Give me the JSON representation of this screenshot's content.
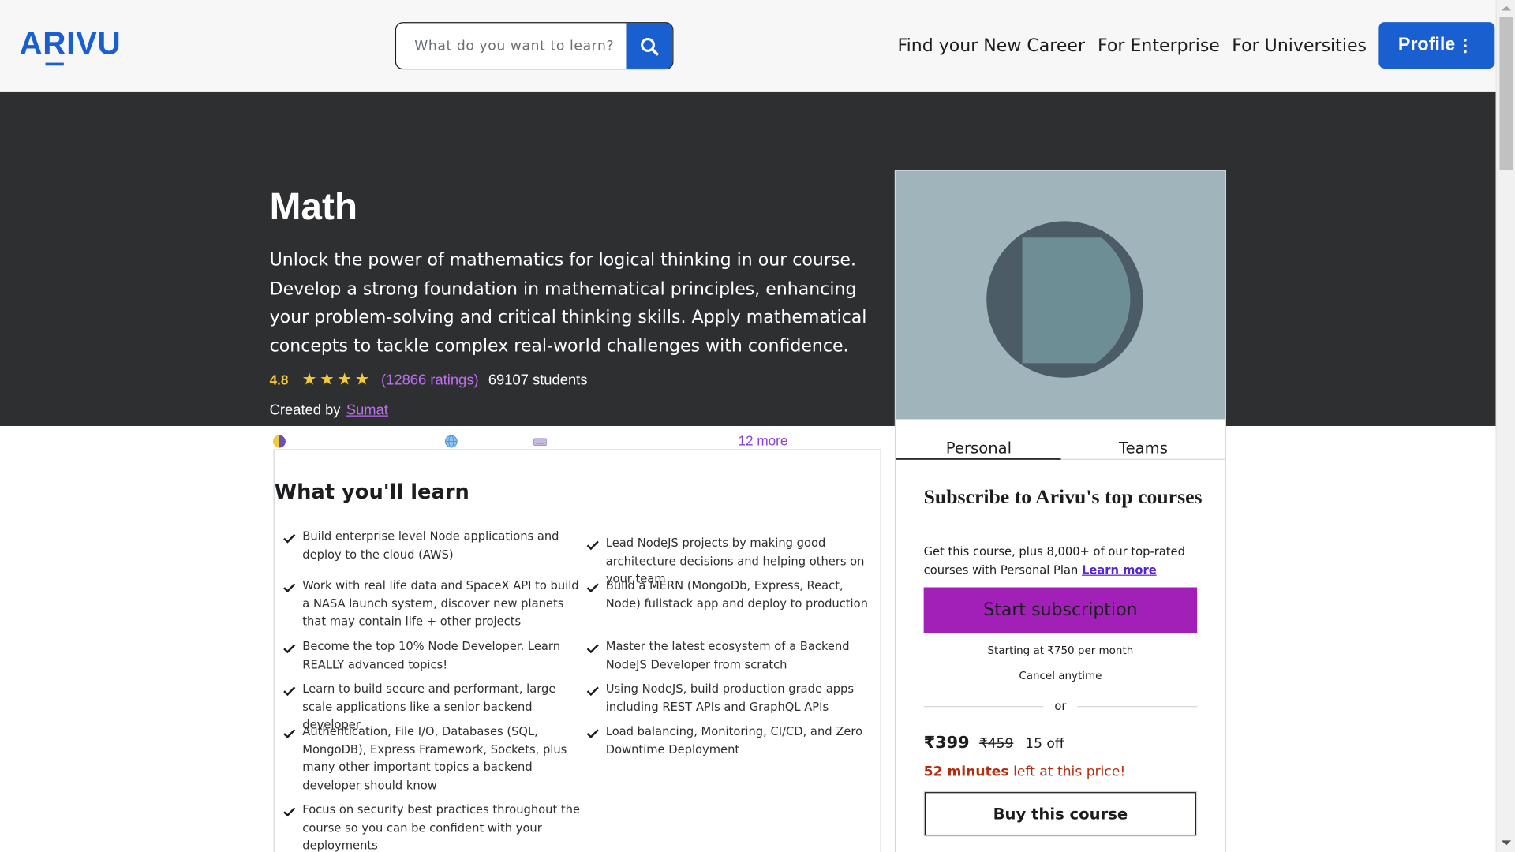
{
  "header": {
    "logo": "ARIVU",
    "search_placeholder": "What do you want to learn?",
    "nav": [
      "Find your New Career",
      "For Enterprise",
      "For Universities"
    ],
    "profile_label": "Profile"
  },
  "course": {
    "title": "Math",
    "description": "Unlock the power of mathematics for logical thinking in our course. Develop a strong foundation in mathematical principles, enhancing your problem-solving and critical thinking skills. Apply mathematical concepts to tackle complex real-world challenges with confidence.",
    "rating": "4.8",
    "ratings_count": "(12866 ratings)",
    "students": "69107 students",
    "created_by_label": "Created by",
    "author": "Sumat",
    "more_label": "12 more",
    "star_rating": 4.8
  },
  "learn": {
    "heading": "What you'll learn",
    "left": [
      "Build enterprise level Node applications and deploy to the cloud (AWS)",
      "Work with real life data and SpaceX API to build a NASA launch system, discover new planets that may contain life + other projects",
      "Become the top 10% Node Developer. Learn REALLY advanced topics!",
      "Learn to build secure and performant, large scale applications like a senior backend developer",
      "Authentication, File I/O, Databases (SQL, MongoDB), Express Framework, Sockets, plus many other important topics a backend developer should know",
      "Focus on security best practices throughout the course so you can be confident with your deployments"
    ],
    "right": [
      "Lead NodeJS projects by making good architecture decisions and helping others on your team",
      "Build a MERN (MongoDb, Express, React, Node) fullstack app and deploy to production",
      "Master the latest ecosystem of a Backend NodeJS Developer from scratch",
      "Using NodeJS, build production grade apps including REST APIs and GraphQL APIs",
      "Load balancing, Monitoring, CI/CD, and Zero Downtime Deployment"
    ]
  },
  "card": {
    "tabs": [
      "Personal",
      "Teams"
    ],
    "sub_title": "Subscribe to Arivu's top courses",
    "sub_text": "Get this course, plus 8,000+ of our top-rated courses with Personal Plan",
    "learn_more": "Learn more",
    "start_label": "Start subscription",
    "starting_at": "Starting at ₹750 per month",
    "cancel": "Cancel anytime",
    "or": "or",
    "price": "₹399",
    "old_price": "₹459",
    "off": "15 off",
    "minutes": "52 minutes",
    "left_text": "left at this price!",
    "buy_label": "Buy this course"
  },
  "colors": {
    "brand": "#1a5fd0",
    "hero_bg": "#2d2f31",
    "subscribe": "#a21fb8",
    "star": "#f3ca3c"
  }
}
